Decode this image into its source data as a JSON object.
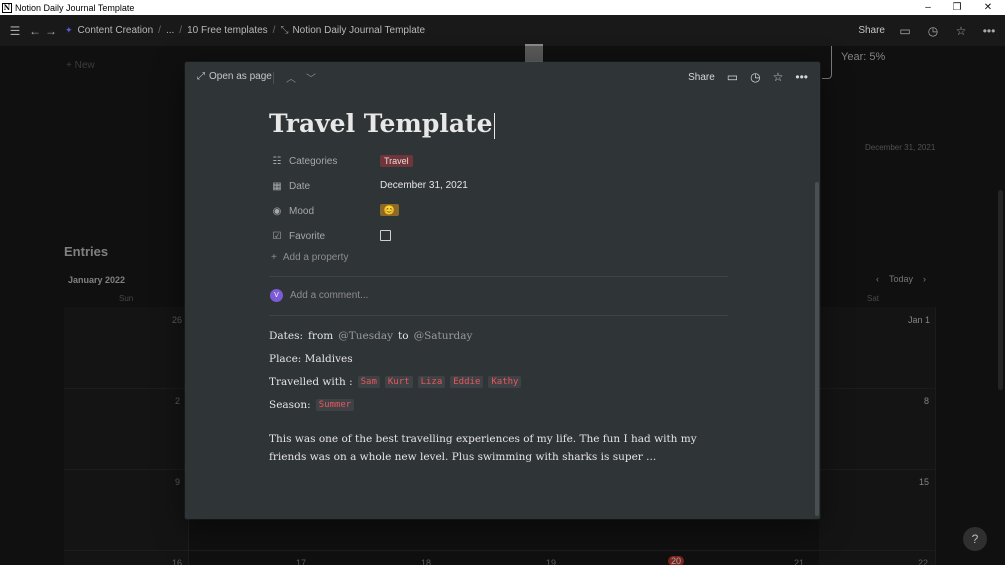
{
  "window": {
    "title": "Notion Daily Journal Template",
    "app_icon_glyph": "N",
    "controls": {
      "minimize": "–",
      "restore": "❐",
      "close": "✕"
    }
  },
  "topbar": {
    "breadcrumbs": [
      "Content Creation",
      "...",
      "10 Free templates",
      "Notion Daily Journal Template"
    ],
    "share_label": "Share"
  },
  "background": {
    "new_label": "New",
    "year_progress": "Year: 5%",
    "date_label": "December 31, 2021",
    "section_title": "Entries",
    "month_label": "January 2022",
    "today_label": "Today",
    "day_headers": [
      "Sun",
      "Sat"
    ],
    "calendar_numbers": [
      "26",
      "Jan 1",
      "2",
      "8",
      "9",
      "15",
      "16",
      "17",
      "18",
      "19",
      "20",
      "21",
      "22"
    ],
    "help_label": "?"
  },
  "modal": {
    "open_as_page_label": "Open as page",
    "share_label": "Share",
    "title": "Travel Template",
    "properties": [
      {
        "name": "Categories",
        "icon": "list-icon",
        "value": "Travel"
      },
      {
        "name": "Date",
        "icon": "calendar-icon",
        "value": "December 31, 2021"
      },
      {
        "name": "Mood",
        "icon": "select-icon",
        "value": "😊"
      },
      {
        "name": "Favorite",
        "icon": "checkbox-icon",
        "value": ""
      }
    ],
    "add_property_label": "Add a property",
    "comment": {
      "avatar_initial": "V",
      "placeholder": "Add a comment..."
    },
    "body": {
      "dates_label": "Dates:",
      "dates_from": "from",
      "dates_start": "@Tuesday",
      "dates_to": "to",
      "dates_end": "@Saturday",
      "place": "Place: Maldives",
      "travelled_with_label": "Travelled with :",
      "companions": [
        "Sam",
        "Kurt",
        "Liza",
        "Eddie",
        "Kathy"
      ],
      "season_label": "Season:",
      "season_value": "Summer",
      "paragraph": "This was one of the best travelling experiences of my life. The fun I had with my friends was on a whole new level. Plus swimming with sharks is super ..."
    }
  },
  "colors": {
    "background": "#191919",
    "modal": "#2f3437",
    "tag_travel": "#6e363b",
    "code_text": "#eb5757",
    "avatar": "#7b5cd6"
  }
}
